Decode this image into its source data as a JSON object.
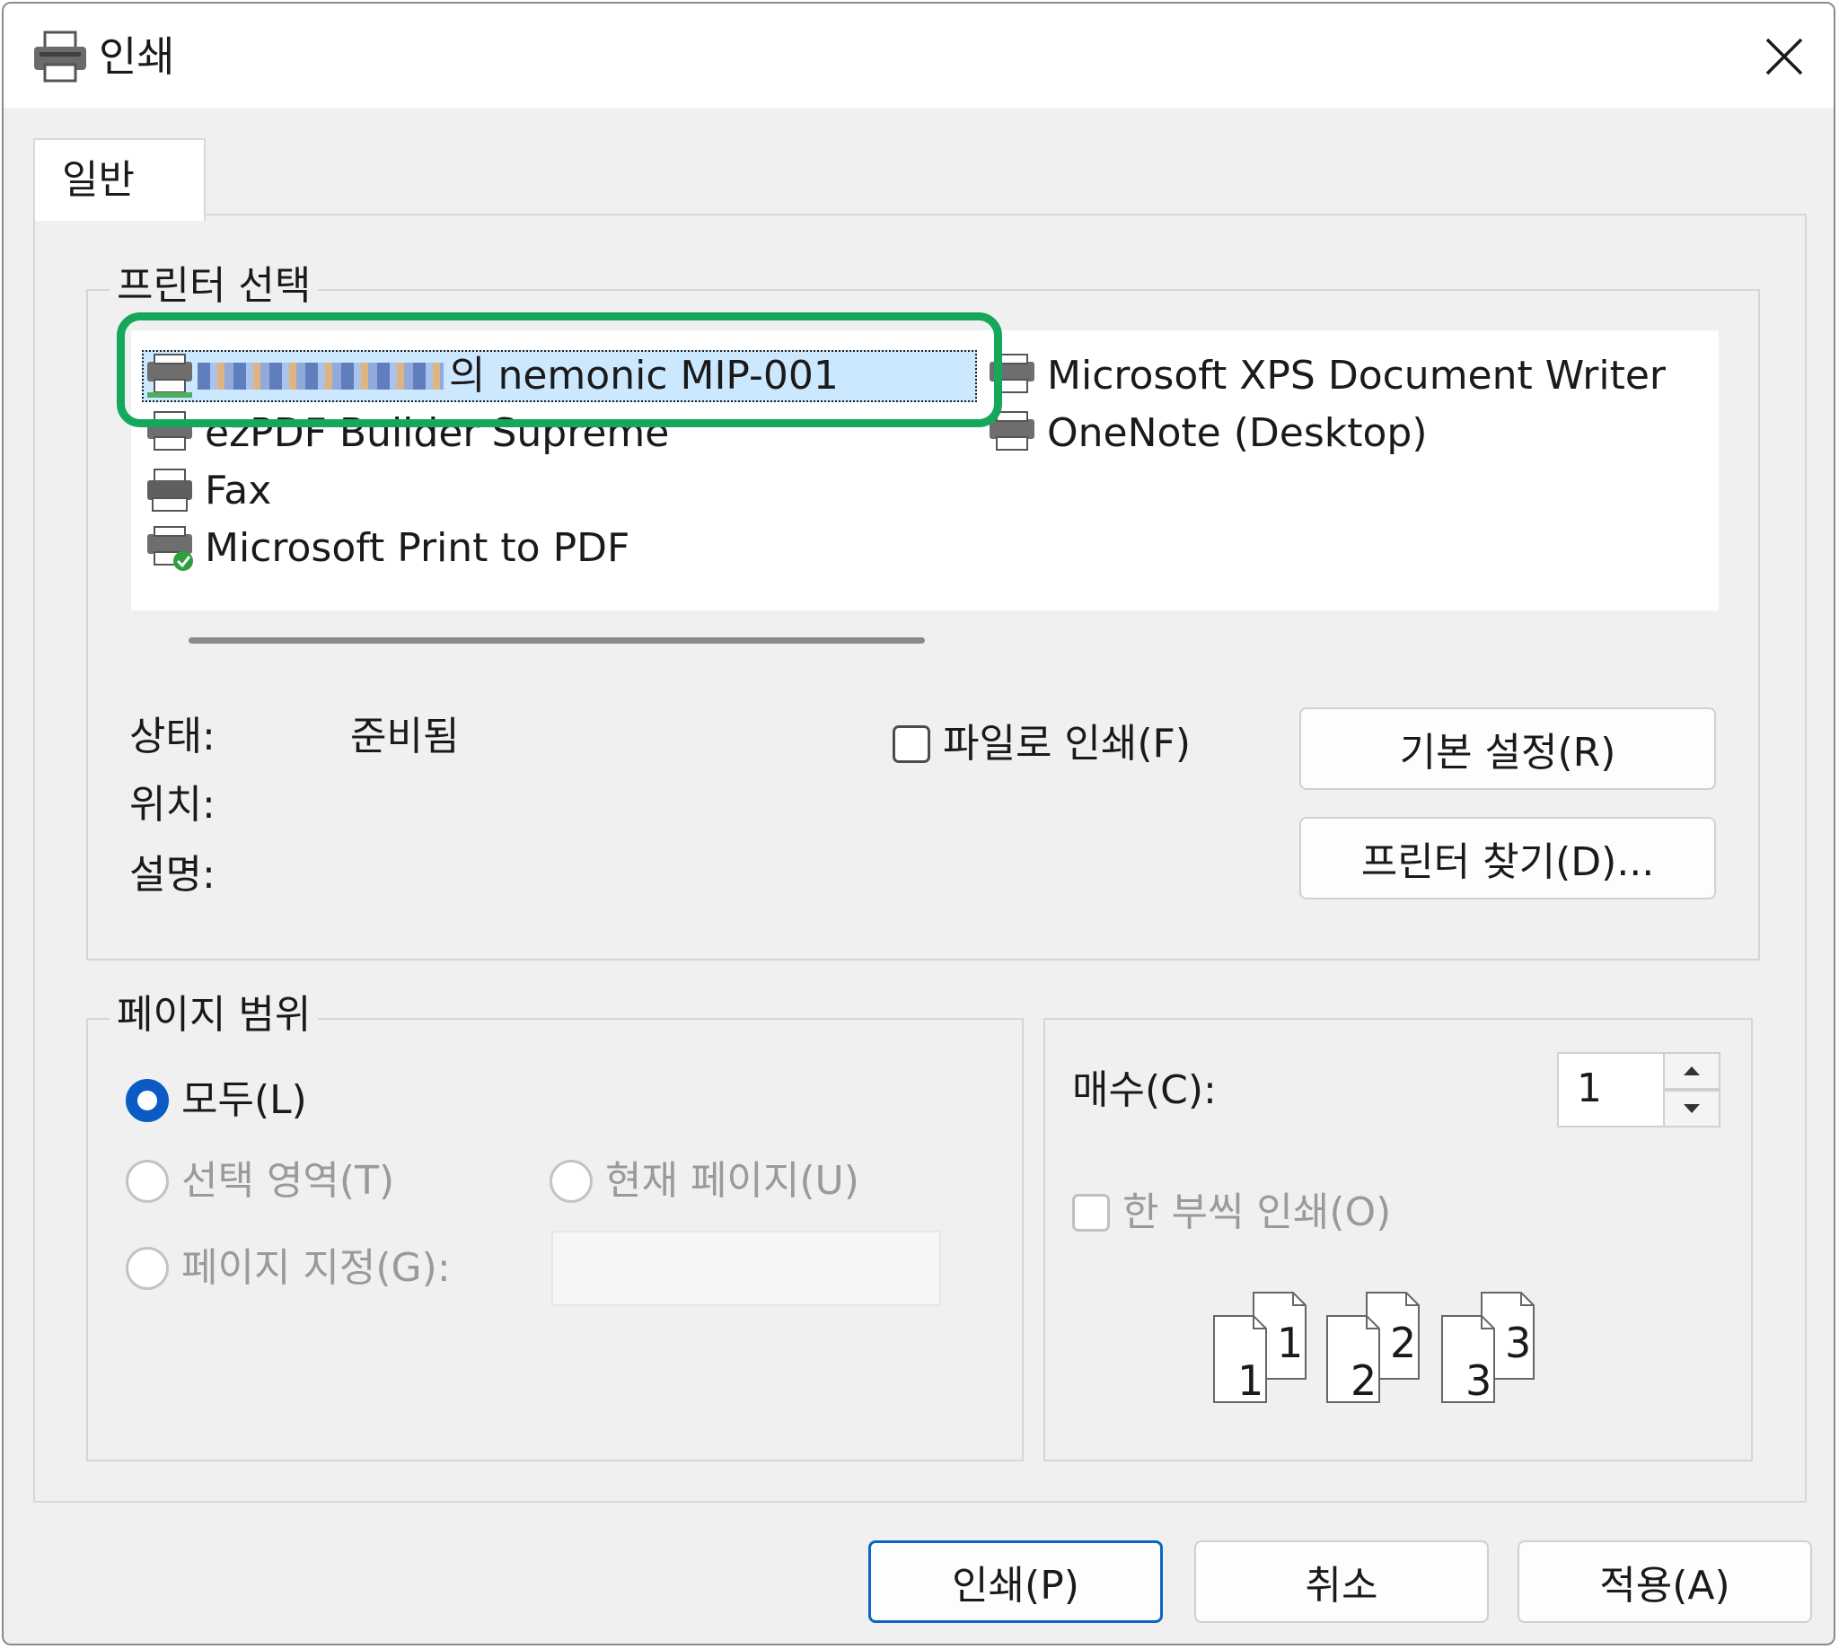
{
  "window": {
    "title": "인쇄"
  },
  "tabs": [
    {
      "label": "일반"
    }
  ],
  "printer_group": {
    "legend": "프린터 선택",
    "printers": [
      {
        "name": "의 nemonic MIP-001",
        "selected": true
      },
      {
        "name": "ezPDF Builder Supreme"
      },
      {
        "name": "Fax"
      },
      {
        "name": "Microsoft Print to PDF"
      },
      {
        "name": "Microsoft XPS Document Writer"
      },
      {
        "name": "OneNote (Desktop)"
      }
    ],
    "status_label": "상태:",
    "status_value": "준비됨",
    "location_label": "위치:",
    "comment_label": "설명:",
    "print_to_file": "파일로 인쇄(F)",
    "preferences_button": "기본 설정(R)",
    "find_printer_button": "프린터 찾기(D)..."
  },
  "page_range": {
    "legend": "페이지 범위",
    "all": "모두(L)",
    "selection": "선택 영역(T)",
    "current_page": "현재 페이지(U)",
    "pages": "페이지 지정(G):"
  },
  "copies": {
    "label": "매수(C):",
    "value": "1",
    "collate": "한 부씩 인쇄(O)",
    "collate_pages": [
      "1",
      "1",
      "2",
      "2",
      "3",
      "3"
    ]
  },
  "footer": {
    "print_button": "인쇄(P)",
    "cancel_button": "취소",
    "apply_button": "적용(A)"
  },
  "colors": {
    "accent": "#0a5bc4",
    "highlight": "#15a85a",
    "selection": "#cce8ff"
  }
}
